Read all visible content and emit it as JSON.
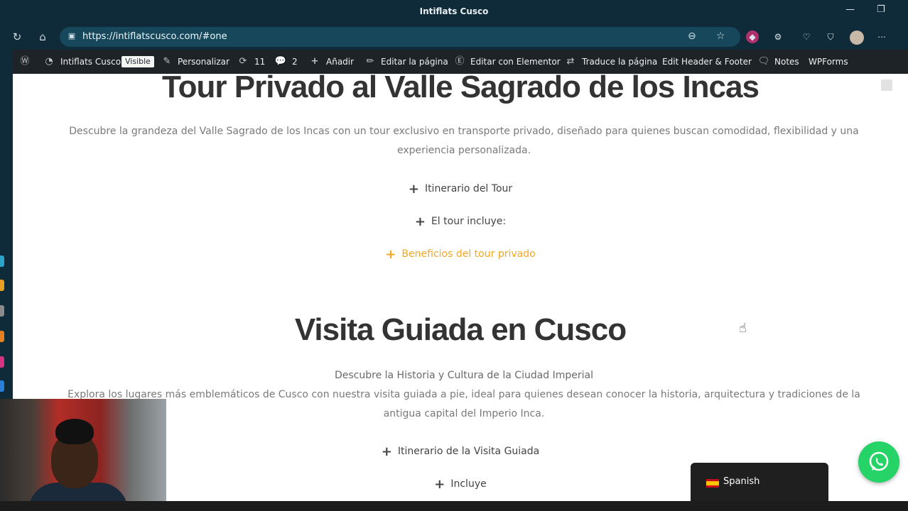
{
  "window": {
    "title": "Intiflats Cusco"
  },
  "browser": {
    "url": "https://intiflatscusco.com/#one"
  },
  "wp_admin_bar": {
    "site_name": "Intiflats Cusco",
    "visibility_badge": "Visible",
    "customize": "Personalizar",
    "updates_count": "11",
    "comments_count": "2",
    "add_new": "Añadir",
    "edit_page": "Editar la página",
    "edit_elementor": "Editar con Elementor",
    "translate_page": "Traduce la página",
    "edit_header_footer": "Edit Header & Footer",
    "notes": "Notes",
    "wpforms": "WPForms"
  },
  "section1": {
    "title": "Tour Privado al Valle Sagrado de los Incas",
    "description": "Descubre la grandeza del Valle Sagrado de los Incas con un tour exclusivo en transporte privado, diseñado para quienes buscan comodidad, flexibilidad y una experiencia personalizada.",
    "accordion": [
      "Itinerario del Tour",
      "El tour incluye:",
      "Beneficios del tour privado"
    ]
  },
  "section2": {
    "title": "Visita Guiada en Cusco",
    "subtitle": "Descubre la Historia y Cultura de la Ciudad Imperial",
    "description": "Explora los lugares más emblemáticos de Cusco con nuestra visita guiada a pie, ideal para quienes desean conocer la historia, arquitectura y tradiciones de la antigua capital del Imperio Inca.",
    "accordion": [
      "Itinerario de la Visita Guiada",
      "Incluye"
    ]
  },
  "language_switcher": {
    "label": "Spanish"
  },
  "colors": {
    "accent": "#f5a623",
    "whatsapp": "#25d366",
    "wp_bar": "#1d2327",
    "browser_chrome": "#0f2a38"
  }
}
